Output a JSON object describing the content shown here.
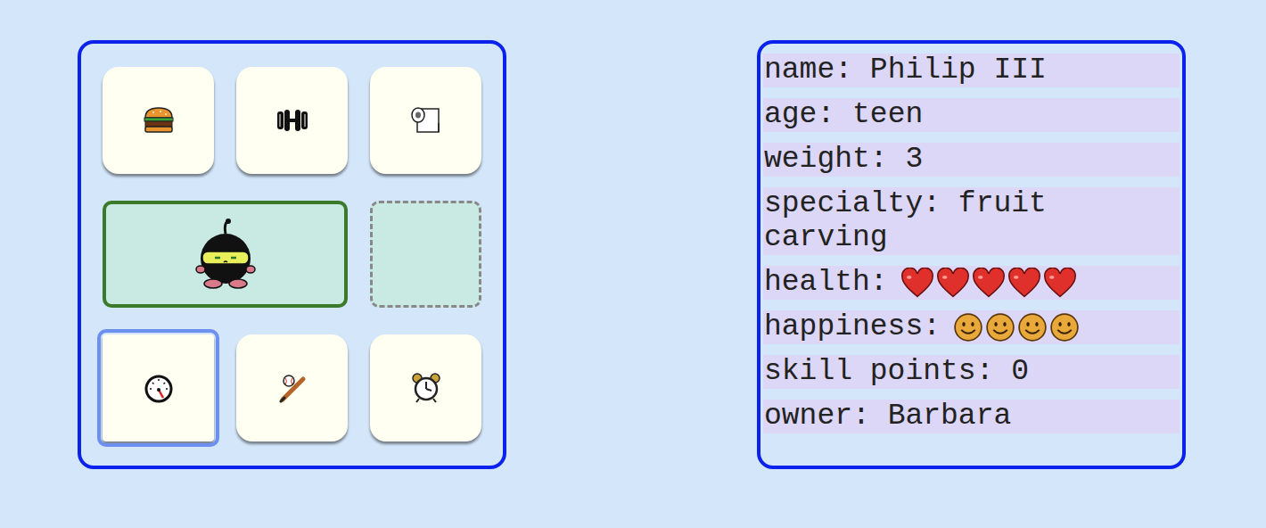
{
  "top_buttons": [
    {
      "kind": "food",
      "selected": false
    },
    {
      "kind": "exercise",
      "selected": false
    },
    {
      "kind": "toilet",
      "selected": false
    }
  ],
  "bottom_buttons": [
    {
      "kind": "stats",
      "selected": true
    },
    {
      "kind": "play",
      "selected": false
    },
    {
      "kind": "alarm",
      "selected": false
    }
  ],
  "stats": [
    {
      "kind": "text",
      "label": "name:",
      "value": "Philip III"
    },
    {
      "kind": "text",
      "label": "age:",
      "value": "teen"
    },
    {
      "kind": "text",
      "label": "weight:",
      "value": "3"
    },
    {
      "kind": "text",
      "label": "specialty:",
      "value": "fruit carving"
    },
    {
      "kind": "hearts",
      "label": "health:",
      "count": 5
    },
    {
      "kind": "smileys",
      "label": "happiness:",
      "count": 4
    },
    {
      "kind": "text",
      "label": "skill points:",
      "value": "0"
    },
    {
      "kind": "text",
      "label": "owner:",
      "value": "Barbara"
    }
  ]
}
